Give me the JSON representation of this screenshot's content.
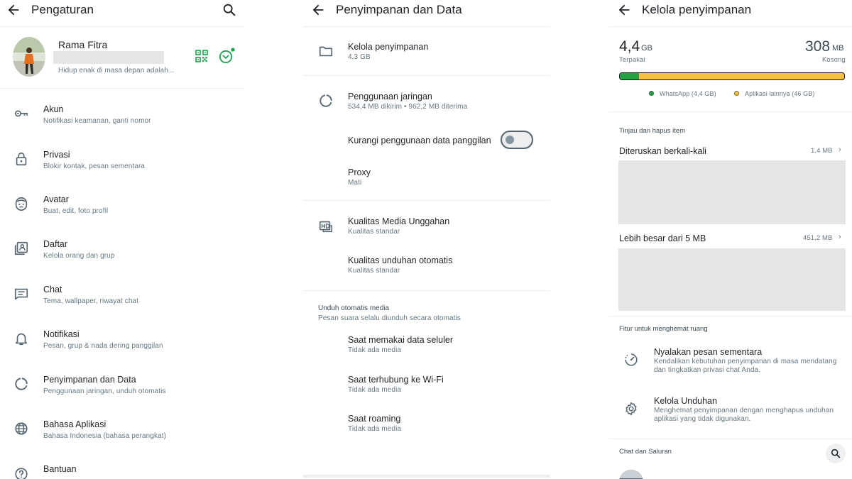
{
  "settings": {
    "title": "Pengaturan",
    "profile": {
      "name": "Rama Fitra",
      "about": "Hidup enak di masa depan adalah..."
    },
    "items": [
      {
        "title": "Akun",
        "subtitle": "Notifikasi keamanan, ganti nomor",
        "icon": "key-icon"
      },
      {
        "title": "Privasi",
        "subtitle": "Blokir kontak, pesan sementara",
        "icon": "lock-icon"
      },
      {
        "title": "Avatar",
        "subtitle": "Buat, edit, foto profil",
        "icon": "avatar-face-icon"
      },
      {
        "title": "Daftar",
        "subtitle": "Kelola orang dan grup",
        "icon": "contact-list-icon"
      },
      {
        "title": "Chat",
        "subtitle": "Tema, wallpaper, riwayat chat",
        "icon": "chat-icon"
      },
      {
        "title": "Notifikasi",
        "subtitle": "Pesan, grup & nada dering panggilan",
        "icon": "bell-icon"
      },
      {
        "title": "Penyimpanan dan Data",
        "subtitle": "Penggunaan jaringan, unduh otomatis",
        "icon": "data-usage-icon"
      },
      {
        "title": "Bahasa Aplikasi",
        "subtitle": "Bahasa Indonesia (bahasa perangkat)",
        "icon": "globe-icon"
      },
      {
        "title": "Bantuan",
        "subtitle": "",
        "icon": "help-icon"
      }
    ]
  },
  "storage_data": {
    "title": "Penyimpanan dan Data",
    "manage": {
      "title": "Kelola penyimpanan",
      "subtitle": "4,3 GB"
    },
    "network": {
      "title": "Penggunaan jaringan",
      "subtitle": "534,4 MB dikirim • 962,2 MB diterima"
    },
    "less_data": {
      "title": "Kurangi penggunaan data panggilan",
      "enabled": false
    },
    "proxy": {
      "title": "Proxy",
      "subtitle": "Mati"
    },
    "upload_quality": {
      "title": "Kualitas Media Unggahan",
      "subtitle": "Kualitas standar"
    },
    "auto_download_quality": {
      "title": "Kualitas unduhan otomatis",
      "subtitle": "Kualitas standar"
    },
    "auto_download": {
      "section": "Unduh otomatis media",
      "note": "Pesan suara selalu diunduh secara otomatis",
      "items": [
        {
          "title": "Saat memakai data seluler",
          "subtitle": "Tidak ada media"
        },
        {
          "title": "Saat terhubung ke Wi-Fi",
          "subtitle": "Tidak ada media"
        },
        {
          "title": "Saat roaming",
          "subtitle": "Tidak ada media"
        }
      ]
    }
  },
  "manage_storage": {
    "title": "Kelola penyimpanan",
    "used": {
      "value": "4,4",
      "unit": "GB",
      "label": "Terpakai"
    },
    "free": {
      "value": "308",
      "unit": "MB",
      "label": "Kosong"
    },
    "bar": {
      "whatsapp_fraction": 0.085,
      "whatsapp_color": "#25a244",
      "other_color": "#f5c144"
    },
    "legend": {
      "whatsapp": "WhatsApp (4,4 GB)",
      "other": "Aplikasi lainnya (46 GB)"
    },
    "review_section": "Tinjau dan hapus item",
    "forwarded": {
      "title": "Diteruskan berkali-kali",
      "size": "1,4 MB"
    },
    "larger": {
      "title": "Lebih besar dari 5 MB",
      "size": "451,2 MB"
    },
    "features_section": "Fitur untuk menghemat ruang",
    "features": [
      {
        "title": "Nyalakan pesan sementara",
        "line1": "Kendalikan kebutuhan penyimpanan di masa mendatang",
        "line2": "dan tingkatkan privasi chat Anda.",
        "icon": "timer-icon"
      },
      {
        "title": "Kelola Unduhan",
        "line1": "Menghemat penyimpanan dengan menghapus unduhan",
        "line2": "aplikasi yang tidak digunakan.",
        "icon": "gear-icon"
      }
    ],
    "chats_section": "Chat dan Saluran"
  }
}
